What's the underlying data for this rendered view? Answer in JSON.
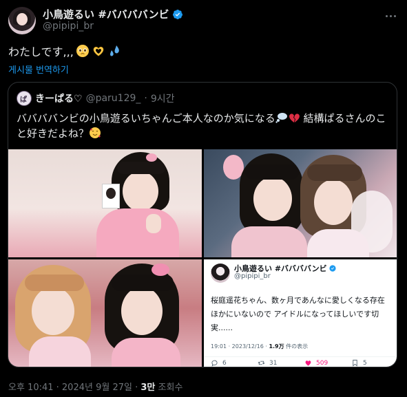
{
  "author": {
    "display_name": "小鳥遊るい #ババババンビ",
    "handle": "@pipipi_br"
  },
  "tweet": {
    "text": "わたしです,,,",
    "emojis": [
      "pleading-face-emoji",
      "heart-hands-emoji",
      "sweat-droplets-emoji"
    ],
    "translate_label": "게시물 번역하기"
  },
  "quote": {
    "display_name": "きーぱる♡",
    "handle": "@paru129_",
    "separator": "·",
    "time": "9시간",
    "text_line1": "ババババンビの小鳥遊るいちゃんご本人なのか気になる",
    "text_line1b": " 結構ぱるさんのこ",
    "text_line2": "と好きだよね？",
    "embedded_card": {
      "display_name": "小鳥遊るい #ババババンビ",
      "handle": "@pipipi_br",
      "text": "桜庭遥花ちゃん、数ヶ月であんなに愛しくなる存在ほかにいないので アイドルになってほしいです切実......",
      "time": "19:01 · 2023/12/16 ·",
      "views_count": "1.9万",
      "views_label": "件の表示",
      "replies": "6",
      "reposts": "31",
      "likes": "509",
      "bookmarks": "5"
    }
  },
  "footer": {
    "time": "오후 10:41 · 2024년 9월 27일 ·",
    "views_count": "3만",
    "views_label": "조회수"
  },
  "colors": {
    "background": "#000000",
    "accent": "#1d9bf0",
    "text_primary": "#e7e9ea",
    "text_secondary": "#71767b",
    "like": "#f91880"
  }
}
